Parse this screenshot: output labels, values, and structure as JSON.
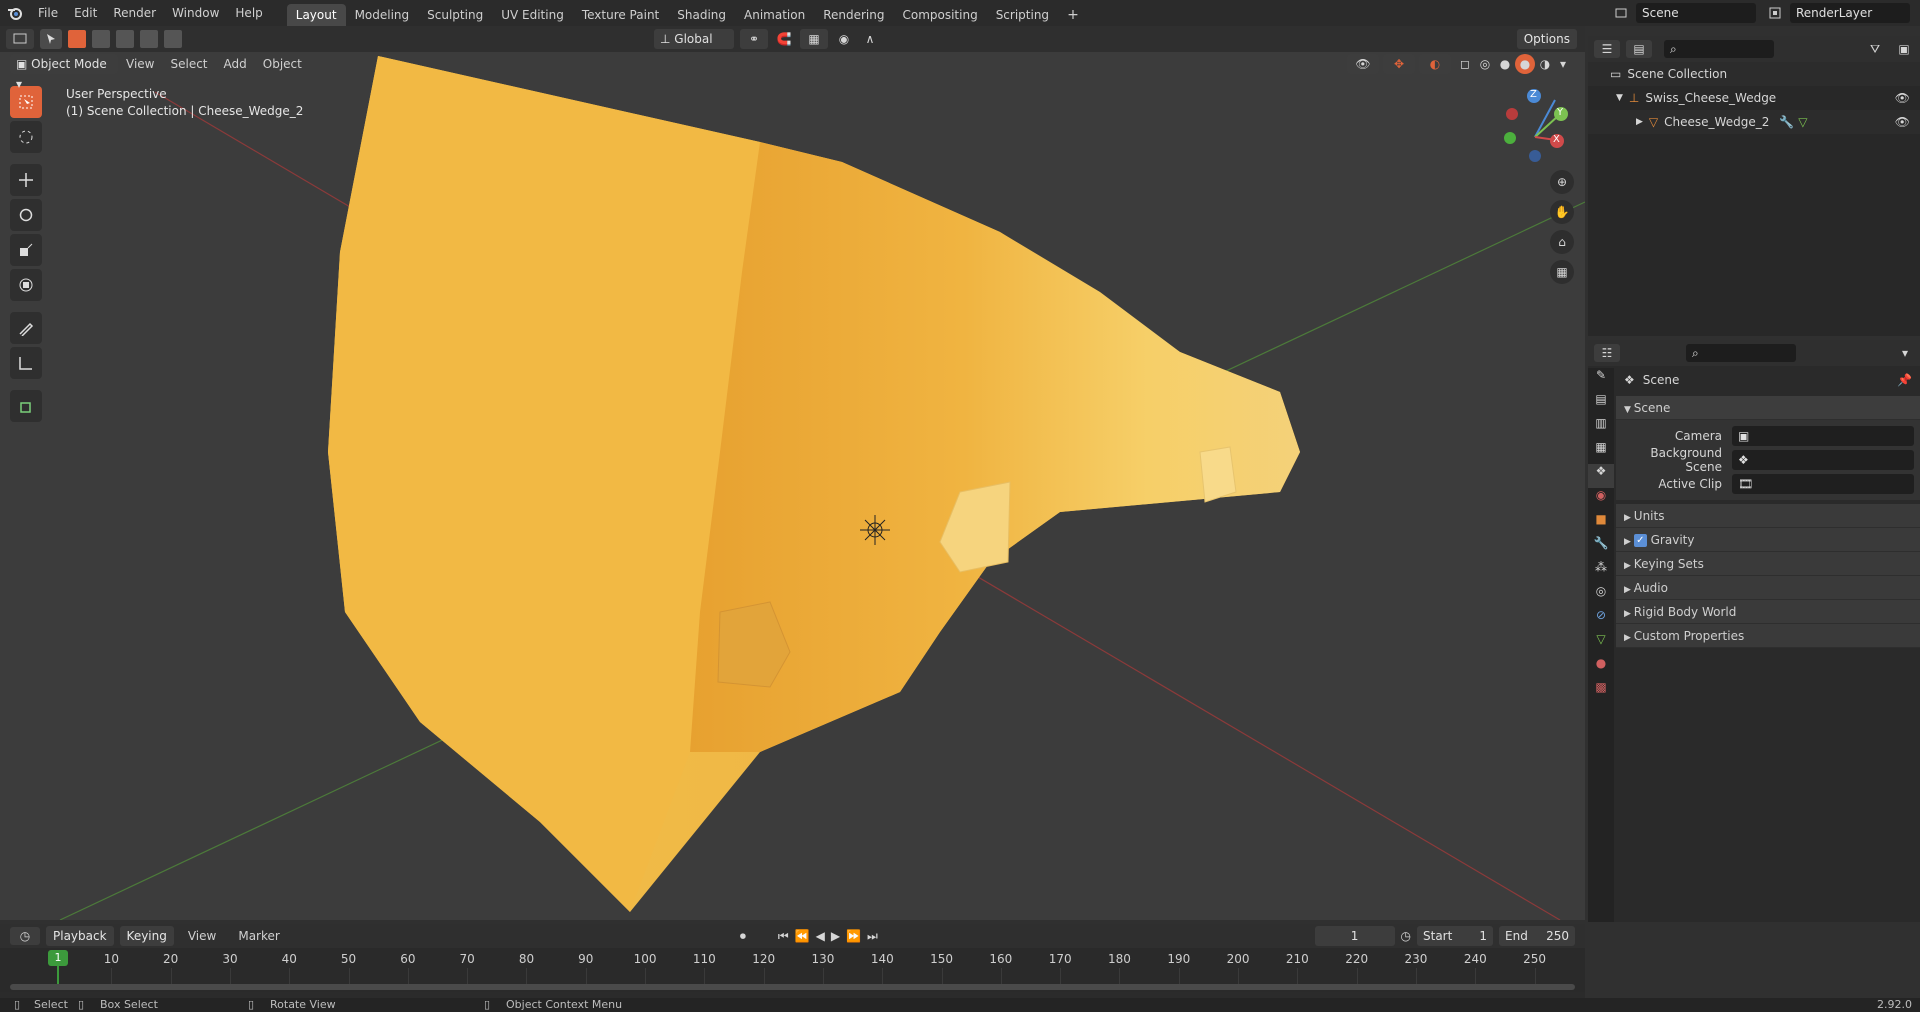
{
  "menus": [
    "File",
    "Edit",
    "Render",
    "Window",
    "Help"
  ],
  "workspaces": [
    "Layout",
    "Modeling",
    "Sculpting",
    "UV Editing",
    "Texture Paint",
    "Shading",
    "Animation",
    "Rendering",
    "Compositing",
    "Scripting"
  ],
  "active_workspace": "Layout",
  "scene_name": "Scene",
  "view_layer": "RenderLayer",
  "toolbar": {
    "mode": "Object Mode",
    "menus": [
      "View",
      "Select",
      "Add",
      "Object"
    ],
    "orientation": "Global",
    "options": "Options"
  },
  "viewport": {
    "overlay_line1": "User Perspective",
    "overlay_line2": "(1) Scene Collection | Cheese_Wedge_2",
    "axis_labels": {
      "x": "X",
      "y": "Y",
      "z": "Z"
    }
  },
  "outliner": {
    "root": "Scene Collection",
    "items": [
      {
        "label": "Swiss_Cheese_Wedge"
      },
      {
        "label": "Cheese_Wedge_2"
      }
    ]
  },
  "properties": {
    "header": "Scene",
    "panel": "Scene",
    "fields": [
      {
        "label": "Camera"
      },
      {
        "label": "Background Scene"
      },
      {
        "label": "Active Clip"
      }
    ],
    "subpanels": [
      "Units",
      "Gravity",
      "Keying Sets",
      "Audio",
      "Rigid Body World",
      "Custom Properties"
    ],
    "gravity_checked": true
  },
  "timeline": {
    "menus": [
      "Playback",
      "Keying",
      "View",
      "Marker"
    ],
    "current_frame": "1",
    "start_label": "Start",
    "start": "1",
    "end_label": "End",
    "end": "250",
    "ticks": [
      "10",
      "20",
      "30",
      "40",
      "50",
      "60",
      "70",
      "80",
      "90",
      "100",
      "110",
      "120",
      "130",
      "140",
      "150",
      "160",
      "170",
      "180",
      "190",
      "200",
      "210",
      "220",
      "230",
      "240",
      "250"
    ],
    "playhead": "1"
  },
  "status": {
    "select": "Select",
    "box_select": "Box Select",
    "rotate": "Rotate View",
    "context": "Object Context Menu",
    "version": "2.92.0"
  },
  "colors": {
    "accent": "#e0633a",
    "cheese": "#f2b53c",
    "x_axis": "#d04a4a",
    "y_axis": "#7cc251",
    "z_axis": "#4b8ad6"
  }
}
